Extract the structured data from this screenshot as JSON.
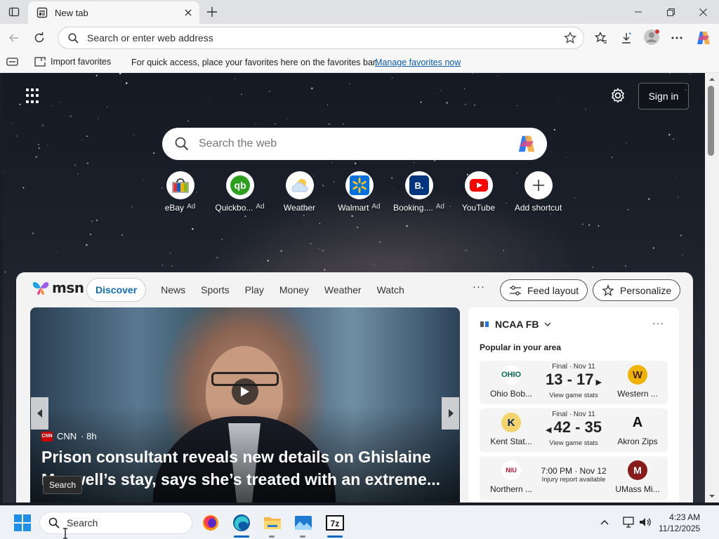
{
  "browser": {
    "tab": {
      "title": "New tab"
    },
    "address": {
      "placeholder": "Search or enter web address"
    },
    "favorites_bar": {
      "import_label": "Import favorites",
      "hint": "For quick access, place your favorites here on the favorites bar.",
      "manage_link": "Manage favorites now"
    }
  },
  "newtab": {
    "signin_label": "Sign in",
    "search_placeholder": "Search the web",
    "shortcuts": [
      {
        "label": "eBay",
        "ad": "Ad",
        "icon": "ebay-bag-icon"
      },
      {
        "label": "Quickbo...",
        "ad": "Ad",
        "icon": "quickbooks-icon"
      },
      {
        "label": "Weather",
        "ad": "",
        "icon": "weather-cloud-icon"
      },
      {
        "label": "Walmart",
        "ad": "Ad",
        "icon": "walmart-spark-icon"
      },
      {
        "label": "Booking....",
        "ad": "Ad",
        "icon": "booking-icon"
      },
      {
        "label": "YouTube",
        "ad": "",
        "icon": "youtube-play-icon"
      },
      {
        "label": "Add shortcut",
        "ad": "",
        "icon": "plus-icon"
      }
    ]
  },
  "feed": {
    "logo_text": "msn",
    "tabs": [
      "Discover",
      "News",
      "Sports",
      "Play",
      "Money",
      "Weather",
      "Watch"
    ],
    "more": "···",
    "feed_layout_label": "Feed layout",
    "personalize_label": "Personalize",
    "hero": {
      "source": "CNN",
      "source_logo": "CNN",
      "age": "· 8h",
      "headline": "Prison consultant reveals new details on Ghislaine Maxwell’s stay, says she’s treated with an extreme..."
    },
    "tooltip": "Search",
    "sports": {
      "league": "NCAA FB",
      "more": "···",
      "subtitle": "Popular in your area",
      "games": [
        {
          "status": "Final · Nov 11",
          "score": "13 - 17",
          "sub": "View game stats",
          "home": "Ohio Bob...",
          "away": "Western ...",
          "home_logo": "OHIO",
          "away_logo": "W",
          "winner_arrow": "right"
        },
        {
          "status": "Final · Nov 11",
          "score": "42 - 35",
          "sub": "View game stats",
          "home": "Kent Stat...",
          "away": "Akron Zips",
          "home_logo": "K",
          "away_logo": "A",
          "winner_arrow": "left"
        },
        {
          "status": "",
          "time": "7:00 PM · Nov 12",
          "sub": "Injury report available",
          "home": "Northern ...",
          "away": "UMass Mi...",
          "home_logo": "NIU",
          "away_logo": "M"
        }
      ]
    }
  },
  "taskbar": {
    "search_placeholder": "Search",
    "time": "4:23 AM",
    "date": "11/12/2025"
  },
  "colors": {
    "accent": "#0f6cbd",
    "link": "#0b5cad",
    "taskbar_bg": "#eef1f6"
  }
}
